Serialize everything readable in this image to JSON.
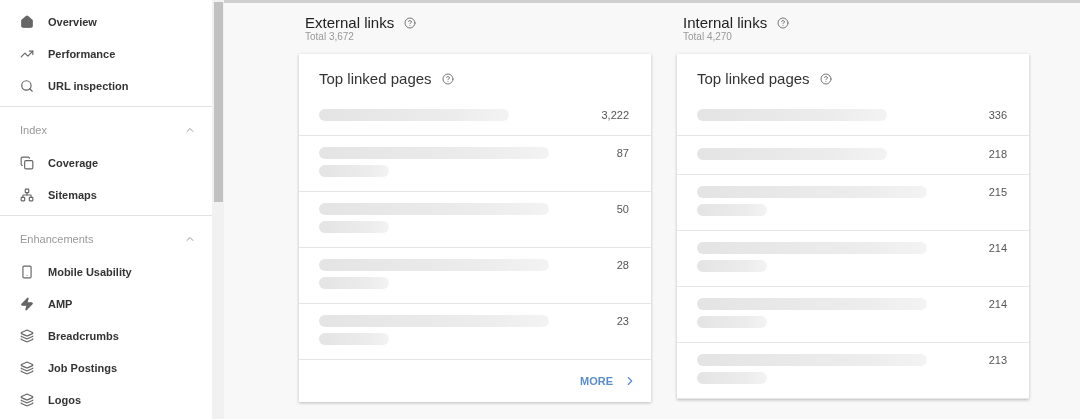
{
  "sidebar": {
    "items": [
      {
        "label": "Overview"
      },
      {
        "label": "Performance"
      },
      {
        "label": "URL inspection"
      }
    ],
    "sections": [
      {
        "title": "Index",
        "expanded": true,
        "items": [
          {
            "label": "Coverage"
          },
          {
            "label": "Sitemaps"
          }
        ]
      },
      {
        "title": "Enhancements",
        "expanded": true,
        "items": [
          {
            "label": "Mobile Usability"
          },
          {
            "label": "AMP"
          },
          {
            "label": "Breadcrumbs"
          },
          {
            "label": "Job Postings"
          },
          {
            "label": "Logos"
          }
        ]
      }
    ]
  },
  "panels": [
    {
      "title": "External links",
      "total": "Total 3,672",
      "card": {
        "title": "Top linked pages",
        "rows": [
          {
            "kind": "short",
            "count": "3,222"
          },
          {
            "kind": "wrapped",
            "count": "87"
          },
          {
            "kind": "wrapped",
            "count": "50"
          },
          {
            "kind": "wrapped",
            "count": "28"
          },
          {
            "kind": "wrapped",
            "count": "23"
          }
        ],
        "more": "MORE"
      }
    },
    {
      "title": "Internal links",
      "total": "Total 4,270",
      "card": {
        "title": "Top linked pages",
        "rows": [
          {
            "kind": "short",
            "count": "336"
          },
          {
            "kind": "short",
            "count": "218"
          },
          {
            "kind": "wrapped",
            "count": "215"
          },
          {
            "kind": "wrapped",
            "count": "214"
          },
          {
            "kind": "wrapped",
            "count": "214"
          },
          {
            "kind": "wrapped",
            "count": "213"
          }
        ]
      }
    }
  ]
}
